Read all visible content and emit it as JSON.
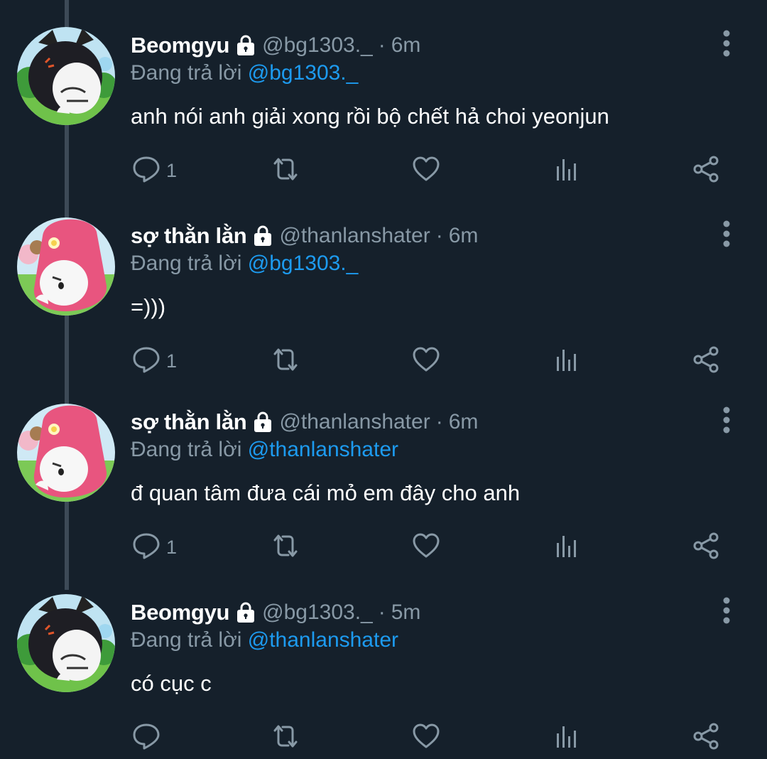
{
  "tweets": [
    {
      "name": "Beomgyu",
      "handle": "@bg1303._",
      "dot": "·",
      "time": "6m",
      "reply_prefix": "Đang trả lời ",
      "reply_mention": "@bg1303._",
      "text": "anh nói anh giải xong rồi bộ chết hả choi yeonjun",
      "reply_count": "1",
      "avatar": "kuromi"
    },
    {
      "name": "sợ thằn lằn",
      "handle": "@thanlanshater",
      "dot": "·",
      "time": "6m",
      "reply_prefix": "Đang trả lời ",
      "reply_mention": "@bg1303._",
      "text": "=)))",
      "reply_count": "1",
      "avatar": "my-melody"
    },
    {
      "name": "sợ thằn lằn",
      "handle": "@thanlanshater",
      "dot": "·",
      "time": "6m",
      "reply_prefix": "Đang trả lời ",
      "reply_mention": "@thanlanshater",
      "text": "đ quan tâm đưa cái mỏ em đây cho anh",
      "reply_count": "1",
      "avatar": "my-melody"
    },
    {
      "name": "Beomgyu",
      "handle": "@bg1303._",
      "dot": "·",
      "time": "5m",
      "reply_prefix": "Đang trả lời ",
      "reply_mention": "@thanlanshater",
      "text": "có cục c",
      "reply_count": "",
      "avatar": "kuromi"
    }
  ],
  "icons": {
    "lock": "lock-icon",
    "more": "more-vertical-icon",
    "reply": "reply-icon",
    "retweet": "retweet-icon",
    "like": "heart-icon",
    "analytics": "analytics-icon",
    "share": "share-icon"
  },
  "colors": {
    "background": "#15202b",
    "text": "#ffffff",
    "muted": "#8899a6",
    "mention": "#1d9bf0",
    "thread_line": "#3d4a57"
  }
}
